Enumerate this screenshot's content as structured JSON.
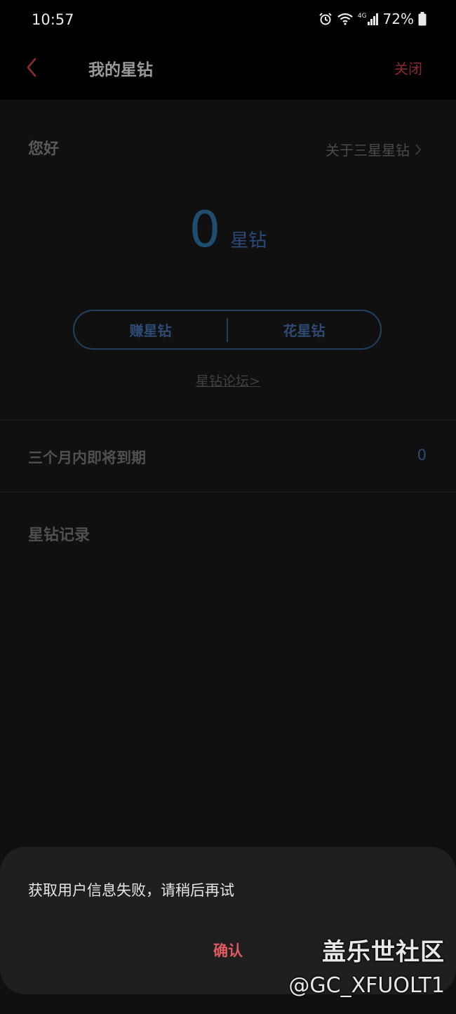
{
  "status_bar": {
    "time": "10:57",
    "battery": "72%",
    "icons": [
      "alarm-icon",
      "wifi-icon",
      "signal-4g-icon",
      "battery-icon"
    ],
    "network_label": "4G"
  },
  "header": {
    "title": "我的星钻",
    "close_label": "关闭",
    "back_icon": "chevron-left-icon",
    "accent_color": "#8a2a30"
  },
  "summary": {
    "greeting": "您好",
    "about_label": "关于三星星钻",
    "balance_value": "0",
    "balance_unit": "星钻",
    "earn_label": "赚星钻",
    "spend_label": "花星钻",
    "forum_link": "星钻论坛>"
  },
  "expiring": {
    "label": "三个月内即将到期",
    "value": "0"
  },
  "records": {
    "title": "星钻记录"
  },
  "dialog": {
    "message": "获取用户信息失败，请稍后再试",
    "confirm_label": "确认",
    "confirm_color": "#e05a63"
  },
  "watermark": {
    "brand": "盖乐世社区",
    "handle": "@GC_XFUOLT1"
  }
}
